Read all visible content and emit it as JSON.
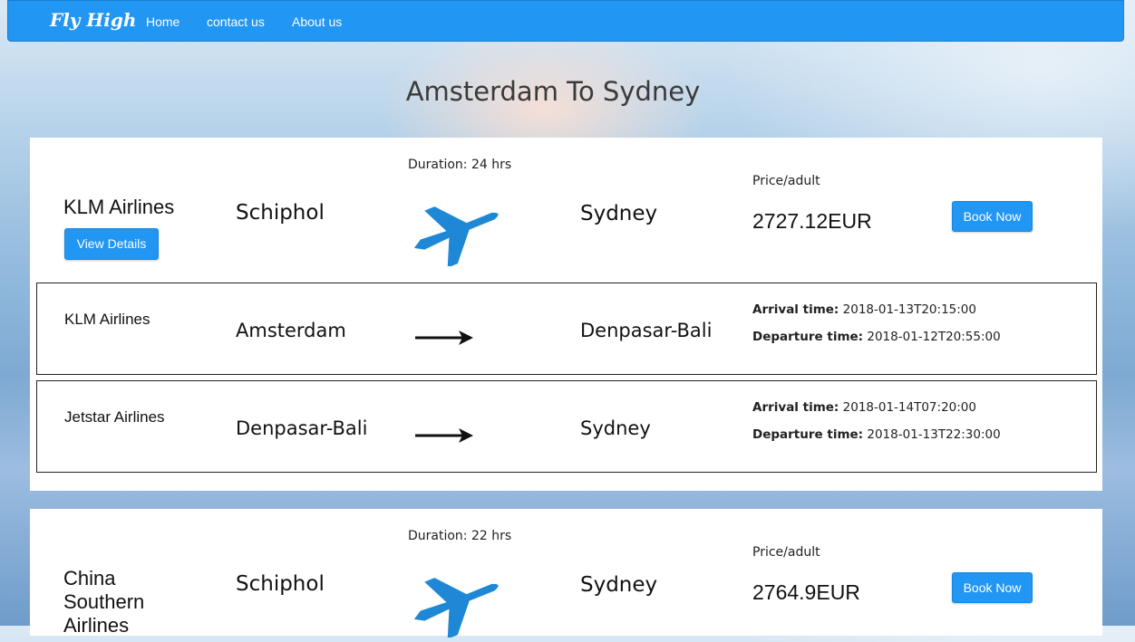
{
  "navbar": {
    "brand": "Fly High",
    "links": [
      "Home",
      "contact us",
      "About us"
    ]
  },
  "page_title": "Amsterdam To Sydney",
  "flights": [
    {
      "airline": "KLM Airlines",
      "from": "Schiphol",
      "to": "Sydney",
      "duration": "Duration: 24 hrs",
      "price_label": "Price/adult",
      "price": "2727.12EUR",
      "view_details": "View Details",
      "book_now": "Book Now",
      "segments": [
        {
          "airline": "KLM Airlines",
          "from": "Amsterdam",
          "to": "Denpasar-Bali",
          "arrival_label": "Arrival time:",
          "arrival": "2018-01-13T20:15:00",
          "departure_label": "Departure time:",
          "departure": "2018-01-12T20:55:00"
        },
        {
          "airline": "Jetstar Airlines",
          "from": "Denpasar-Bali",
          "to": "Sydney",
          "arrival_label": "Arrival time:",
          "arrival": "2018-01-14T07:20:00",
          "departure_label": "Departure time:",
          "departure": "2018-01-13T22:30:00"
        }
      ]
    },
    {
      "airline": "China Southern Airlines",
      "from": "Schiphol",
      "to": "Sydney",
      "duration": "Duration: 22 hrs",
      "price_label": "Price/adult",
      "price": "2764.9EUR",
      "book_now": "Book Now"
    }
  ],
  "colors": {
    "accent": "#2196f3",
    "plane": "#1e88d6"
  },
  "icons": {
    "plane": "airplane-icon",
    "arrow": "right-arrow-icon"
  }
}
